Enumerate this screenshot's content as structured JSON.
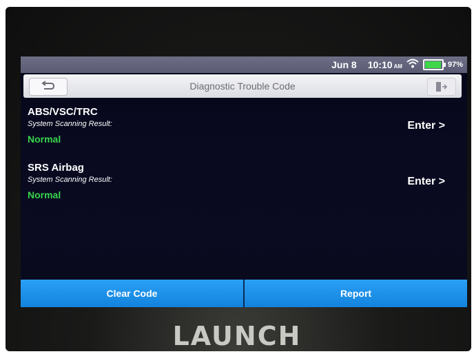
{
  "status_bar": {
    "date": "Jun 8",
    "time": "10:10",
    "ampm": "AM",
    "battery_percent": "97%",
    "battery_level": 0.97,
    "battery_color": "#3fd64a"
  },
  "header": {
    "title": "Diagnostic Trouble Code",
    "back_icon": "back-arrow-icon",
    "exit_icon": "exit-icon"
  },
  "systems": [
    {
      "name": "ABS/VSC/TRC",
      "subtitle": "System Scanning Result:",
      "status": "Normal",
      "action": "Enter >"
    },
    {
      "name": "SRS Airbag",
      "subtitle": "System Scanning Result:",
      "status": "Normal",
      "action": "Enter >"
    }
  ],
  "footer": {
    "clear_code_label": "Clear Code",
    "report_label": "Report"
  },
  "device_brand": "LAUNCH",
  "colors": {
    "accent": "#1a8fe8",
    "normal_status": "#39d64c"
  }
}
